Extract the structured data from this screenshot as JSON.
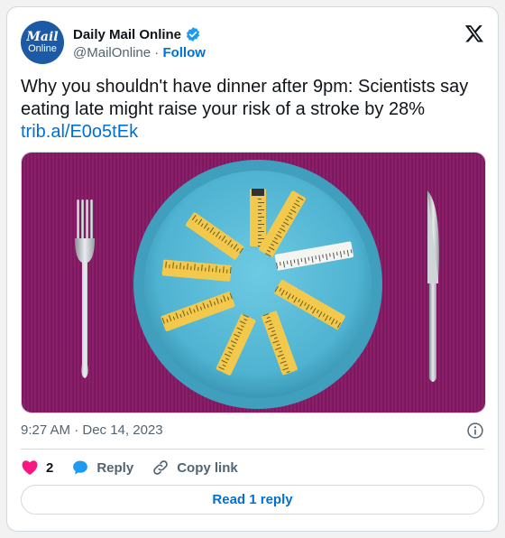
{
  "account": {
    "avatar_line1": "Mail",
    "avatar_line2": "Online",
    "name": "Daily Mail Online",
    "handle": "@MailOnline",
    "separator": " · ",
    "follow_label": "Follow"
  },
  "tweet": {
    "text": "Why you shouldn't have dinner after 9pm: Scientists say eating late might raise your risk of a stroke by 28%",
    "link": "trib.al/E0o5tEk",
    "media_alt": "Plate with tape measures arranged in a star shape, fork and knife on purple placemat",
    "timestamp": "9:27 AM · Dec 14, 2023"
  },
  "actions": {
    "like_count": "2",
    "reply_label": "Reply",
    "copy_link_label": "Copy link",
    "read_reply_label": "Read 1 reply"
  },
  "colors": {
    "link_blue": "#006fd6",
    "heart_pink": "#f91880",
    "reply_blue": "#1d9bf0",
    "placemat_purple": "#8c1f6a",
    "plate_blue": "#56b9d6",
    "tape_yellow": "#f2c94c"
  },
  "icons": [
    "verified-badge-icon",
    "x-logo-icon",
    "info-icon",
    "heart-icon",
    "reply-bubble-icon",
    "link-icon"
  ]
}
